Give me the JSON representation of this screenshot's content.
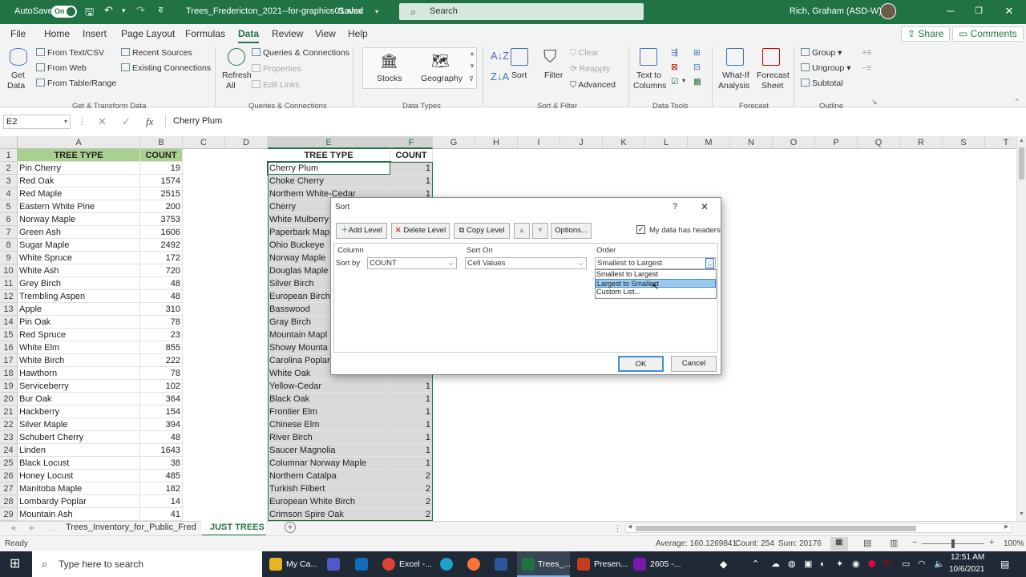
{
  "titlebar": {
    "autosave_label": "AutoSave",
    "autosave_state": "On",
    "file_name": "Trees_Fredericton_2021--for-graphics01.xlsx",
    "save_state": "Saved",
    "search_placeholder": "Search",
    "user_name": "Rich, Graham (ASD-W)"
  },
  "menu": {
    "tabs": [
      "File",
      "Home",
      "Insert",
      "Page Layout",
      "Formulas",
      "Data",
      "Review",
      "View",
      "Help"
    ],
    "active": "Data",
    "share_label": "Share",
    "comments_label": "Comments"
  },
  "ribbon": {
    "get_transform": {
      "get_data": [
        "Get",
        "Data"
      ],
      "from_text": "From Text/CSV",
      "from_web": "From Web",
      "from_table": "From Table/Range",
      "recent_sources": "Recent Sources",
      "existing_connections": "Existing Connections",
      "group_label": "Get & Transform Data"
    },
    "queries": {
      "refresh": [
        "Refresh",
        "All"
      ],
      "queries_connections": "Queries & Connections",
      "properties": "Properties",
      "edit_links": "Edit Links",
      "group_label": "Queries & Connections"
    },
    "data_types": {
      "stocks": "Stocks",
      "geography": "Geography",
      "group_label": "Data Types"
    },
    "sort_filter": {
      "sort": "Sort",
      "filter": "Filter",
      "clear": "Clear",
      "reapply": "Reapply",
      "advanced": "Advanced",
      "group_label": "Sort & Filter"
    },
    "data_tools": {
      "text_to_columns": [
        "Text to",
        "Columns"
      ],
      "group_label": "Data Tools"
    },
    "forecast": {
      "what_if": [
        "What-If",
        "Analysis"
      ],
      "forecast_sheet": [
        "Forecast",
        "Sheet"
      ],
      "group_label": "Forecast"
    },
    "outline": {
      "group": "Group",
      "ungroup": "Ungroup",
      "subtotal": "Subtotal",
      "group_label": "Outline"
    }
  },
  "formula_bar": {
    "name_box": "E2",
    "fx": "fx",
    "content": "Cherry Plum"
  },
  "columns": [
    "A",
    "B",
    "C",
    "D",
    "E",
    "F",
    "G",
    "H",
    "I",
    "J",
    "K",
    "L",
    "M",
    "N",
    "O",
    "P",
    "Q",
    "R",
    "S",
    "T"
  ],
  "rows": [
    "1",
    "2",
    "3",
    "4",
    "5",
    "6",
    "7",
    "8",
    "9",
    "10",
    "11",
    "12",
    "13",
    "14",
    "15",
    "16",
    "17",
    "18",
    "19",
    "20",
    "21",
    "22",
    "23",
    "24",
    "25",
    "26",
    "27",
    "28",
    "29"
  ],
  "table_a": {
    "headers": [
      "TREE TYPE",
      "COUNT"
    ],
    "rows": [
      [
        "Pin Cherry",
        "19"
      ],
      [
        "Red Oak",
        "1574"
      ],
      [
        "Red Maple",
        "2515"
      ],
      [
        "Eastern White Pine",
        "200"
      ],
      [
        "Norway Maple",
        "3753"
      ],
      [
        "Green Ash",
        "1606"
      ],
      [
        "Sugar Maple",
        "2492"
      ],
      [
        "White Spruce",
        "172"
      ],
      [
        "White Ash",
        "720"
      ],
      [
        "Grey Birch",
        "48"
      ],
      [
        "Trembling Aspen",
        "48"
      ],
      [
        "Apple",
        "310"
      ],
      [
        "Pin Oak",
        "78"
      ],
      [
        "Red Spruce",
        "23"
      ],
      [
        "White Elm",
        "855"
      ],
      [
        "White Birch",
        "222"
      ],
      [
        "Hawthorn",
        "78"
      ],
      [
        "Serviceberry",
        "102"
      ],
      [
        "Bur Oak",
        "364"
      ],
      [
        "Hackberry",
        "154"
      ],
      [
        "Silver Maple",
        "394"
      ],
      [
        "Schubert Cherry",
        "48"
      ],
      [
        "Linden",
        "1643"
      ],
      [
        "Black Locust",
        "38"
      ],
      [
        "Honey Locust",
        "485"
      ],
      [
        "Manitoba Maple",
        "182"
      ],
      [
        "Lombardy Poplar",
        "14"
      ],
      [
        "Mountain Ash",
        "41"
      ]
    ]
  },
  "table_e": {
    "headers": [
      "TREE TYPE",
      "COUNT"
    ],
    "rows": [
      [
        "Cherry Plum",
        "1"
      ],
      [
        "Choke Cherry",
        "1"
      ],
      [
        "Northern White-Cedar",
        "1"
      ],
      [
        "Cherry",
        ""
      ],
      [
        "White Mulberry",
        ""
      ],
      [
        "Paperbark Map",
        ""
      ],
      [
        "Ohio Buckeye",
        ""
      ],
      [
        "Norway Maple",
        ""
      ],
      [
        "Douglas Maple",
        ""
      ],
      [
        "Silver Birch",
        ""
      ],
      [
        "European Birch",
        ""
      ],
      [
        "Basswood",
        ""
      ],
      [
        "Gray Birch",
        ""
      ],
      [
        "Mountain Mapl",
        ""
      ],
      [
        "Showy Mounta",
        ""
      ],
      [
        "Carolina Poplar",
        ""
      ],
      [
        "White Oak",
        ""
      ],
      [
        "Yellow-Cedar",
        "1"
      ],
      [
        "Black Oak",
        "1"
      ],
      [
        "Frontier Elm",
        "1"
      ],
      [
        "Chinese Elm",
        "1"
      ],
      [
        "River Birch",
        "1"
      ],
      [
        "Saucer Magnolia",
        "1"
      ],
      [
        "Columnar Norway Maple",
        "1"
      ],
      [
        "Northern Catalpa",
        "2"
      ],
      [
        "Turkish Filbert",
        "2"
      ],
      [
        "European White Birch",
        "2"
      ],
      [
        "Crimson Spire Oak",
        "2"
      ]
    ]
  },
  "sort_dialog": {
    "title": "Sort",
    "help": "?",
    "close": "✕",
    "add_level": "Add Level",
    "delete_level": "Delete Level",
    "copy_level": "Copy Level",
    "options": "Options...",
    "my_data_has_headers": "My data has headers",
    "headers_checked": true,
    "col_header": "Column",
    "sort_on_header": "Sort On",
    "order_header": "Order",
    "sort_by_label": "Sort by",
    "sort_by_value": "COUNT",
    "sort_on_value": "Cell Values",
    "order_value": "Smallest to Largest",
    "order_options": [
      "Smallest to Largest",
      "Largest to Smallest",
      "Custom List..."
    ],
    "highlighted_option": "Largest to Smallest",
    "ok": "OK",
    "cancel": "Cancel"
  },
  "sheet_tabs": {
    "tabs": [
      "Trees_Inventory_for_Public_Fred",
      "JUST TREES"
    ],
    "active": "JUST TREES"
  },
  "statusbar": {
    "ready": "Ready",
    "average": "Average: 160.1269841",
    "count": "Count: 254",
    "sum": "Sum: 20176",
    "zoom": "100%"
  },
  "taskbar": {
    "search_placeholder": "Type here to search",
    "apps": [
      "My Ca...",
      "Excel -...",
      "Trees_...",
      "Presen...",
      "2605 -..."
    ],
    "time": "12:51 AM",
    "date": "10/6/2021"
  },
  "colors": {
    "excel_green": "#217346",
    "header_fill": "#a9d08e",
    "taskbar": "#1f2a36"
  }
}
